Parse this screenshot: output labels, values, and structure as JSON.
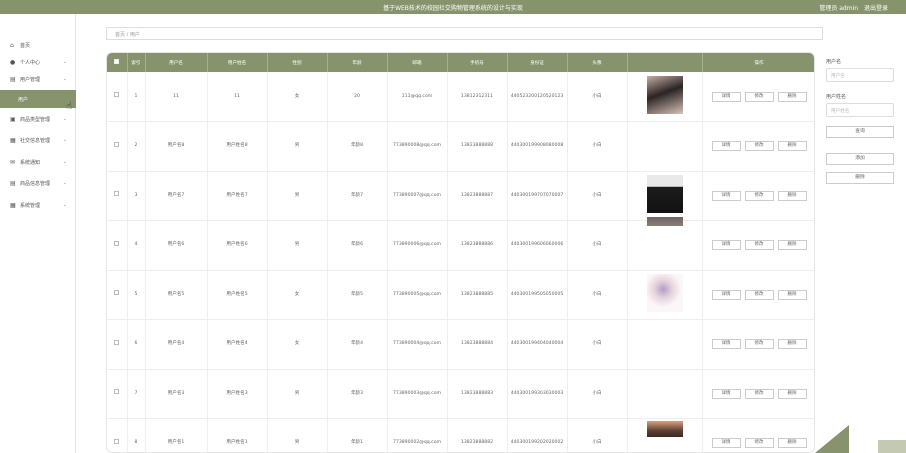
{
  "topbar": {
    "title": "基于WEB技术的校园社交购物管理系统的设计与实现",
    "user_label": "管理员 admin",
    "logout_label": "退出登录"
  },
  "sidebar": {
    "items": [
      {
        "label": "首页",
        "icon": "home-icon",
        "chevron": false
      },
      {
        "label": "个人中心",
        "icon": "person-icon",
        "chevron": true
      },
      {
        "label": "用户管理",
        "icon": "document-icon",
        "chevron": true
      },
      {
        "label": "用户",
        "icon": "",
        "chevron": false,
        "active": true
      },
      {
        "label": "商品类型管理",
        "icon": "box-icon",
        "chevron": true
      },
      {
        "label": "社交信息管理",
        "icon": "grid-icon",
        "chevron": true
      },
      {
        "label": "系统通知",
        "icon": "mail-icon",
        "chevron": true
      },
      {
        "label": "商品信息管理",
        "icon": "document-icon",
        "chevron": true
      },
      {
        "label": "系统管理",
        "icon": "grid-icon",
        "chevron": true
      }
    ]
  },
  "breadcrumb": {
    "home": "首页",
    "sep": "/",
    "current": "用户"
  },
  "table": {
    "headers": [
      "",
      "索引",
      "用户名",
      "用户姓名",
      "性别",
      "年龄",
      "邮箱",
      "手机号",
      "身份证",
      "头像",
      "",
      "操作"
    ],
    "actions": [
      "详情",
      "修改",
      "删除"
    ],
    "rows": [
      {
        "index": "1",
        "username": "11",
        "name": "11",
        "gender": "女",
        "age": "20",
        "email": "111@qq.com",
        "phone": "13812312311",
        "idcard": "440523200120520123",
        "extra": "小白",
        "avatar": "a"
      },
      {
        "index": "2",
        "username": "用户名8",
        "name": "用户姓名8",
        "gender": "男",
        "age": "年龄8",
        "email": "773890008@qq.com",
        "phone": "13823888888",
        "idcard": "440300199908080008",
        "extra": "小白",
        "avatar": ""
      },
      {
        "index": "3",
        "username": "用户名7",
        "name": "用户姓名7",
        "gender": "男",
        "age": "年龄7",
        "email": "773890007@qq.com",
        "phone": "13823888887",
        "idcard": "440300199707070007",
        "extra": "小白",
        "avatar": "b"
      },
      {
        "index": "4",
        "username": "用户名6",
        "name": "用户姓名6",
        "gender": "男",
        "age": "年龄6",
        "email": "773890006@qq.com",
        "phone": "13823888886",
        "idcard": "440300199606060006",
        "extra": "小白",
        "avatar": "c"
      },
      {
        "index": "5",
        "username": "用户名5",
        "name": "用户姓名5",
        "gender": "女",
        "age": "年龄5",
        "email": "773890005@qq.com",
        "phone": "13823888885",
        "idcard": "440300199505050005",
        "extra": "小白",
        "avatar": "d"
      },
      {
        "index": "6",
        "username": "用户名4",
        "name": "用户姓名4",
        "gender": "女",
        "age": "年龄4",
        "email": "773890004@qq.com",
        "phone": "13823888884",
        "idcard": "440300199404040004",
        "extra": "小白",
        "avatar": ""
      },
      {
        "index": "7",
        "username": "用户名3",
        "name": "用户姓名3",
        "gender": "男",
        "age": "年龄3",
        "email": "773890003@qq.com",
        "phone": "13823888883",
        "idcard": "440300199303030003",
        "extra": "小白",
        "avatar": ""
      },
      {
        "index": "8",
        "username": "用户名1",
        "name": "用户姓名1",
        "gender": "男",
        "age": "年龄1",
        "email": "773890002@qq.com",
        "phone": "13823888882",
        "idcard": "440300199202020002",
        "extra": "小白",
        "avatar": "e"
      }
    ]
  },
  "search": {
    "username_label": "用户名",
    "username_placeholder": "用户名",
    "name_label": "用户姓名",
    "name_placeholder": "用户姓名",
    "search_button": "查询",
    "add_button": "添加",
    "delete_button": "删除"
  },
  "colors": {
    "accent": "#87936d"
  }
}
